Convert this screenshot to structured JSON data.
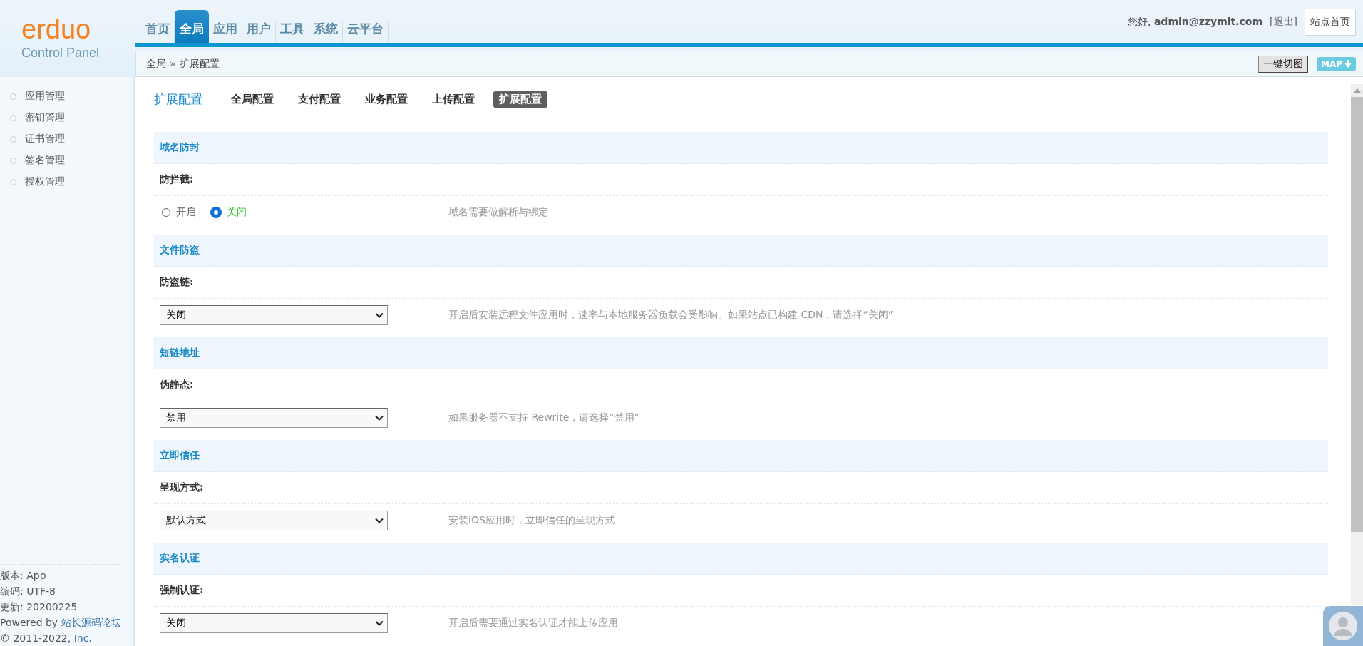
{
  "logo": {
    "name": "erduo",
    "subtitle": "Control Panel"
  },
  "nav": [
    {
      "label": "首页",
      "selected": false
    },
    {
      "label": "全局",
      "selected": true
    },
    {
      "label": "应用",
      "selected": false
    },
    {
      "label": "用户",
      "selected": false
    },
    {
      "label": "工具",
      "selected": false
    },
    {
      "label": "系统",
      "selected": false
    },
    {
      "label": "云平台",
      "selected": false
    }
  ],
  "user": {
    "greeting": "您好,",
    "name": "admin@zzymlt.com",
    "logout": "[退出]",
    "home_button": "站点首页"
  },
  "breadcrumb": {
    "items": [
      "全局",
      "扩展配置"
    ],
    "separator": "»"
  },
  "toolbar": {
    "cut_button": "一键切图",
    "map_button": "MAP"
  },
  "sidebar": {
    "items": [
      {
        "label": "应用管理"
      },
      {
        "label": "密钥管理"
      },
      {
        "label": "证书管理"
      },
      {
        "label": "签名管理"
      },
      {
        "label": "授权管理"
      }
    ],
    "footer": {
      "version": "版本: App",
      "encoding": "编码: UTF-8",
      "updated": "更新: 20200225",
      "powered_prefix": "Powered by",
      "powered_link": "站长源码论坛",
      "copyright_prefix": "© 2011-2022,",
      "copyright_link": "Inc."
    }
  },
  "page": {
    "title": "扩展配置",
    "tabs": [
      {
        "label": "全局配置",
        "selected": false
      },
      {
        "label": "支付配置",
        "selected": false
      },
      {
        "label": "业务配置",
        "selected": false
      },
      {
        "label": "上传配置",
        "selected": false
      },
      {
        "label": "扩展配置",
        "selected": true
      }
    ]
  },
  "sections": [
    {
      "title": "域名防封",
      "label": "防拦截:",
      "kind": "radio",
      "options": [
        {
          "label": "开启",
          "selected": false
        },
        {
          "label": "关闭",
          "selected": true
        }
      ],
      "hint": "域名需要做解析与绑定"
    },
    {
      "title": "文件防盗",
      "label": "防盗链:",
      "kind": "select",
      "value": "关闭",
      "hint": "开启后安装远程文件应用时，速率与本地服务器负载会受影响。如果站点已构建 CDN，请选择“关闭”"
    },
    {
      "title": "短链地址",
      "label": "伪静态:",
      "kind": "select",
      "value": "禁用",
      "hint": "如果服务器不支持 Rewrite，请选择“禁用”"
    },
    {
      "title": "立即信任",
      "label": "呈现方式:",
      "kind": "select",
      "value": "默认方式",
      "hint": "安装iOS应用时，立即信任的呈现方式"
    },
    {
      "title": "实名认证",
      "label": "强制认证:",
      "kind": "select",
      "value": "关闭",
      "hint": "开启后需要通过实名认证才能上传应用"
    }
  ]
}
